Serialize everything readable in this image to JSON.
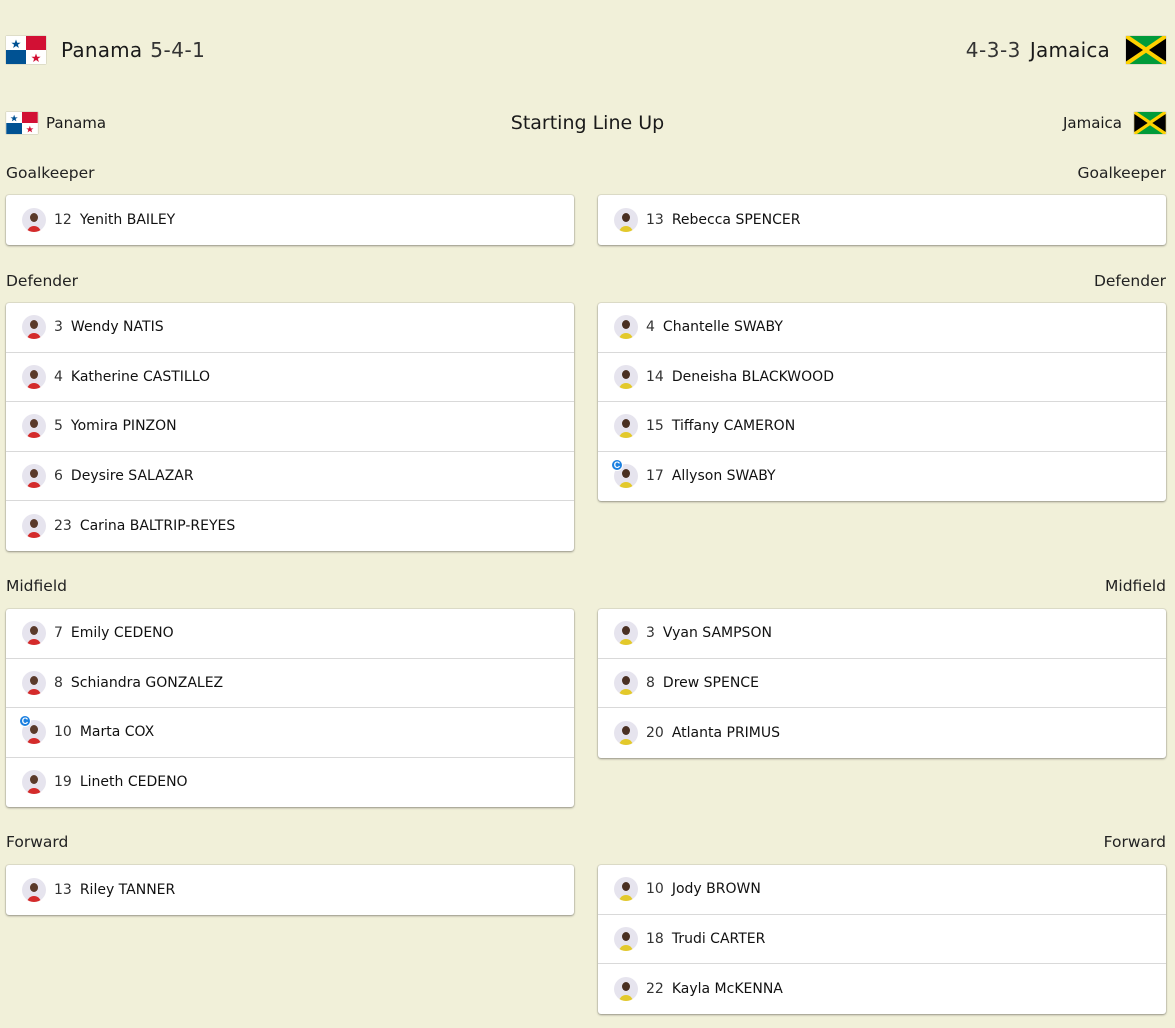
{
  "home": {
    "name": "Panama",
    "formation": "5-4-1",
    "colors": {
      "shirt": "#d42b2b",
      "skin": "#5a3a2a"
    },
    "flag": "panama-flag",
    "goalkeeper": [
      {
        "num": "12",
        "name": "Yenith BAILEY",
        "captain": false
      }
    ],
    "defender": [
      {
        "num": "3",
        "name": "Wendy NATIS",
        "captain": false
      },
      {
        "num": "4",
        "name": "Katherine CASTILLO",
        "captain": false
      },
      {
        "num": "5",
        "name": "Yomira PINZON",
        "captain": false
      },
      {
        "num": "6",
        "name": "Deysire SALAZAR",
        "captain": false
      },
      {
        "num": "23",
        "name": "Carina BALTRIP-REYES",
        "captain": false
      }
    ],
    "midfield": [
      {
        "num": "7",
        "name": "Emily CEDENO",
        "captain": false
      },
      {
        "num": "8",
        "name": "Schiandra GONZALEZ",
        "captain": false
      },
      {
        "num": "10",
        "name": "Marta COX",
        "captain": true
      },
      {
        "num": "19",
        "name": "Lineth CEDENO",
        "captain": false
      }
    ],
    "forward": [
      {
        "num": "13",
        "name": "Riley TANNER",
        "captain": false
      }
    ]
  },
  "away": {
    "name": "Jamaica",
    "formation": "4-3-3",
    "colors": {
      "shirt": "#e3c92b",
      "skin": "#4a3022"
    },
    "flag": "jamaica-flag",
    "goalkeeper": [
      {
        "num": "13",
        "name": "Rebecca SPENCER",
        "captain": false
      }
    ],
    "defender": [
      {
        "num": "4",
        "name": "Chantelle SWABY",
        "captain": false
      },
      {
        "num": "14",
        "name": "Deneisha BLACKWOOD",
        "captain": false
      },
      {
        "num": "15",
        "name": "Tiffany CAMERON",
        "captain": false
      },
      {
        "num": "17",
        "name": "Allyson SWABY",
        "captain": true
      }
    ],
    "midfield": [
      {
        "num": "3",
        "name": "Vyan SAMPSON",
        "captain": false
      },
      {
        "num": "8",
        "name": "Drew SPENCE",
        "captain": false
      },
      {
        "num": "20",
        "name": "Atlanta PRIMUS",
        "captain": false
      }
    ],
    "forward": [
      {
        "num": "10",
        "name": "Jody BROWN",
        "captain": false
      },
      {
        "num": "18",
        "name": "Trudi CARTER",
        "captain": false
      },
      {
        "num": "22",
        "name": "Kayla McKENNA",
        "captain": false
      }
    ]
  },
  "lineup_title": "Starting Line Up",
  "positions": {
    "goalkeeper": "Goalkeeper",
    "defender": "Defender",
    "midfield": "Midfield",
    "forward": "Forward"
  },
  "captain_badge": "C"
}
